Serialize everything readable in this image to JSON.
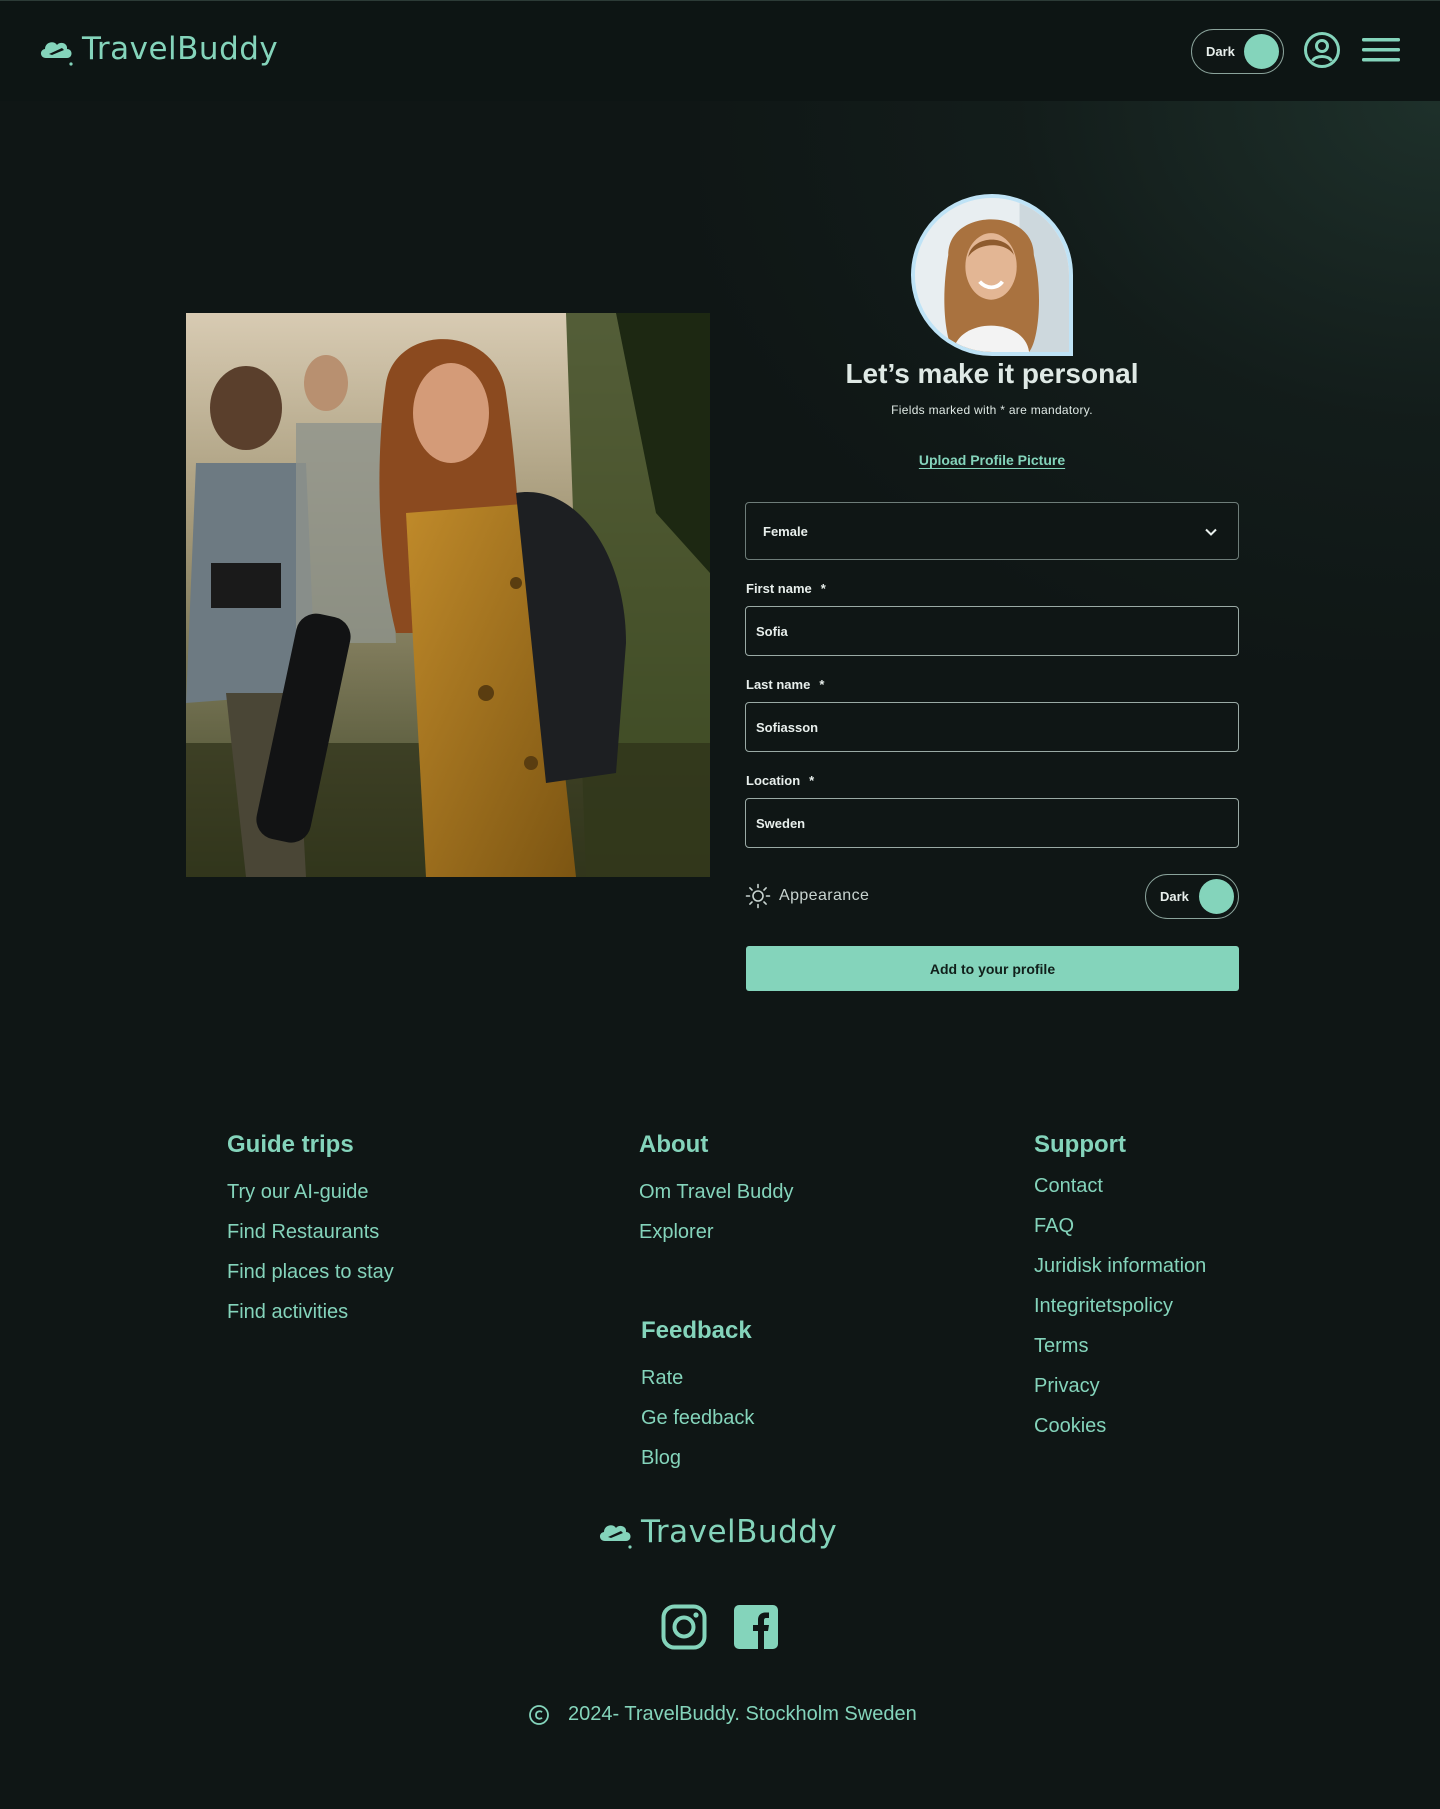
{
  "header": {
    "brand": "TravelBuddy",
    "theme_toggle_label": "Dark",
    "icons": [
      "cloud-plane-logo-icon",
      "user-account-icon",
      "hamburger-menu-icon"
    ]
  },
  "form": {
    "title": "Let’s make it personal",
    "subtitle": "Fields marked with * are mandatory.",
    "upload_link": "Upload Profile Picture",
    "gender_select": {
      "value": "Female"
    },
    "fields": [
      {
        "label": "First name",
        "required_mark": "*",
        "value": "Sofia"
      },
      {
        "label": "Last name",
        "required_mark": "*",
        "value": "Sofiasson"
      },
      {
        "label": "Location",
        "required_mark": "*",
        "value": "Sweden"
      }
    ],
    "appearance_label": "Appearance",
    "appearance_toggle_label": "Dark",
    "submit_label": "Add to your profile"
  },
  "footer": {
    "guide_trips": {
      "heading": "Guide trips",
      "links": [
        "Try our AI-guide",
        "Find Restaurants",
        "Find places to stay",
        "Find activities"
      ]
    },
    "about": {
      "heading": "About",
      "links": [
        "Om Travel Buddy",
        "Explorer"
      ]
    },
    "feedback": {
      "heading": "Feedback",
      "links": [
        "Rate",
        "Ge feedback",
        "Blog"
      ]
    },
    "support": {
      "heading": "Support",
      "links": [
        "Contact",
        "FAQ",
        "Juridisk information",
        "Integritetspolicy",
        "Terms",
        "Privacy",
        "Cookies"
      ]
    },
    "brand": "TravelBuddy",
    "social_icons": [
      "instagram-icon",
      "facebook-icon"
    ],
    "copyright": "2024- TravelBuddy. Stockholm Sweden"
  },
  "colors": {
    "background": "#0f1615",
    "accent": "#84d4bb",
    "avatar_border": "#bfe3f6"
  }
}
